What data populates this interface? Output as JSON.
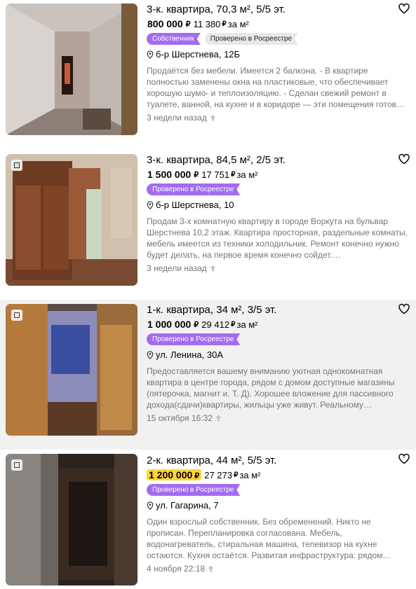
{
  "listings": [
    {
      "title": "3-к. квартира, 70,3 м², 5/5 эт.",
      "price": "800 000",
      "price_per_m2": "11 380",
      "per_m2_suffix": "за м²",
      "price_highlighted": false,
      "badges": [
        "Собственник",
        "Проверено в Росреестре"
      ],
      "address": "б-р Шерстнева, 12Б",
      "description": "Продаётся без мебели. Имеется 2 балкона. - В квартире полностью заменены окна на пластиковые, что обеспечивает хорошую шумо- и теплоизоляцию. - Сделан свежий ремонт в туалете, ванной, на кухне и в коридоре — эти помещения готов…",
      "date": "3 недели назад"
    },
    {
      "title": "3-к. квартира, 84,5 м², 2/5 эт.",
      "price": "1 500 000",
      "price_per_m2": "17 751",
      "per_m2_suffix": "за м²",
      "price_highlighted": false,
      "badges": [
        "Проверено в Росреестре"
      ],
      "address": "б-р Шерстнева, 10",
      "description": "Продам 3-х комнатную квартиру в городе Воркута на бульвар Шерстнева 10,2 этаж. Квартира просторная, раздельные комнаты, мебель имеется из техники холодильник. Ремонт конечно нужно будет делать, на первое время конечно сойдет.…",
      "date": "3 недели назад"
    },
    {
      "title": "1-к. квартира, 34 м², 3/5 эт.",
      "price": "1 000 000",
      "price_per_m2": "29 412",
      "per_m2_suffix": "за м²",
      "price_highlighted": false,
      "badges": [
        "Проверено в Росреестре"
      ],
      "address": "ул. Ленина, 30А",
      "description": "Предоставляется вашему вниманию уютная однокомнатная квартира в центре города, рядом с домом доступные магазины (пятерочка, магнит и. Т. Д). Хорошее вложение для пассивного дохода(сдачи)квартиры, жильцы уже живут. Реальному…",
      "date": "15 октября 16:32"
    },
    {
      "title": "2-к. квартира, 44 м², 5/5 эт.",
      "price": "1 200 000",
      "price_per_m2": "27 273",
      "per_m2_suffix": "за м²",
      "price_highlighted": true,
      "badges": [
        "Проверено в Росреестре"
      ],
      "address": "ул. Гагарина, 7",
      "description": "Один взрослый собственник. Без обременений. Никто не прописан. Перепланировка согласована. Мебель, водонагреватель, стиральная машина, телевизор на кухне остаются. Кухня остаётся. Развитая инфраструктура: рядом…",
      "date": "4 ноября 22:18"
    }
  ],
  "colors": {
    "badge_purple": "#a36cf0",
    "price_highlight": "#ffd43b",
    "muted_text": "#757575",
    "active_card_bg": "#f1f1f1"
  },
  "icons": {
    "favorite": "heart-icon",
    "address": "location-pin-icon",
    "raised": "arrow-up-icon",
    "gallery": "gallery-icon",
    "currency": "ruble-icon"
  }
}
